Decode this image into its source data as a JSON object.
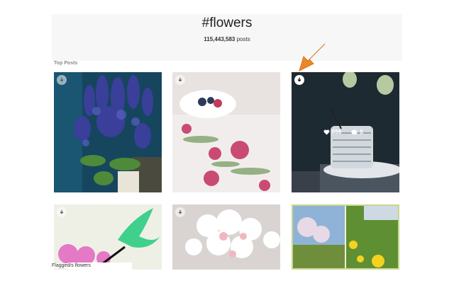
{
  "header": {
    "hashtag": "#flowers",
    "post_count": "115,443,583",
    "post_count_suffix": "posts"
  },
  "section": {
    "label": "Top Posts"
  },
  "posts": [
    {
      "id": "tile-1",
      "likes": "",
      "comments": ""
    },
    {
      "id": "tile-2",
      "likes": "",
      "comments": ""
    },
    {
      "id": "tile-3",
      "likes": "656",
      "comments": "5"
    },
    {
      "id": "tile-4"
    },
    {
      "id": "tile-5"
    },
    {
      "id": "tile-6"
    }
  ],
  "caption": "Flagged/s flowers",
  "icons": {
    "download": "download-icon",
    "heart": "heart-icon",
    "comment": "comment-icon",
    "arrow": "arrow-pointer-icon"
  },
  "colors": {
    "accent_arrow": "#e8882a"
  }
}
